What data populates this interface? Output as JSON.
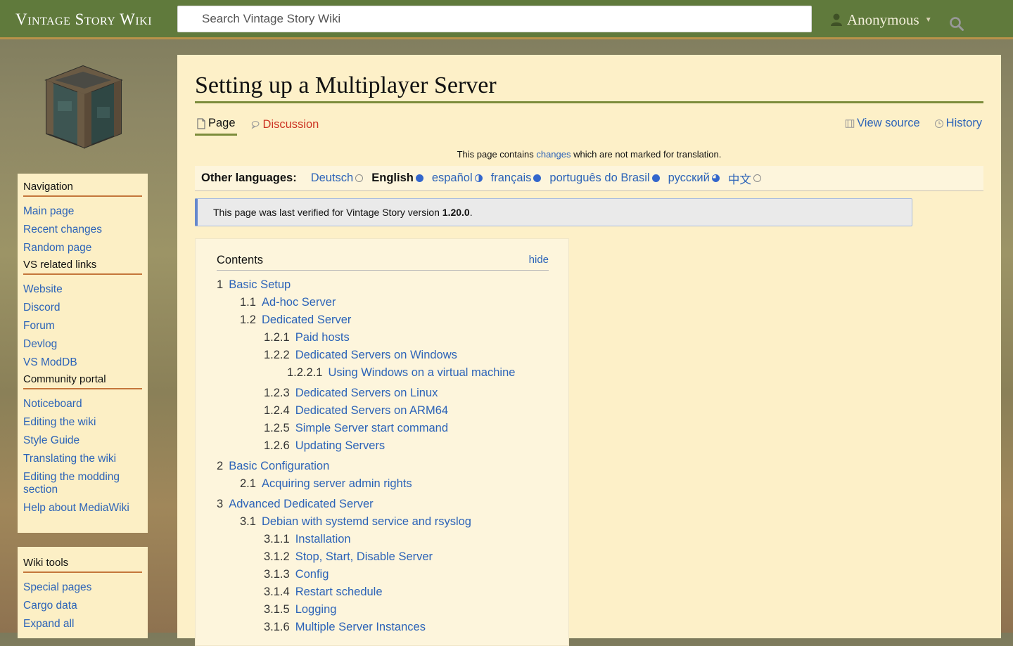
{
  "header": {
    "brand": "Vintage Story Wiki",
    "search_placeholder": "Search Vintage Story Wiki",
    "user_label": "Anonymous"
  },
  "sidebar": {
    "navigation_heading": "Navigation",
    "navigation": [
      "Main page",
      "Recent changes",
      "Random page"
    ],
    "vs_heading": "VS related links",
    "vs_links": [
      "Website",
      "Discord",
      "Forum",
      "Devlog",
      "VS ModDB"
    ],
    "community_heading": "Community portal",
    "community": [
      "Noticeboard",
      "Editing the wiki",
      "Style Guide",
      "Translating the wiki",
      "Editing the modding section",
      "Help about MediaWiki"
    ],
    "tools_heading": "Wiki tools",
    "tools": [
      "Special pages",
      "Cargo data",
      "Expand all"
    ]
  },
  "page": {
    "title": "Setting up a Multiplayer Server",
    "tab_page": "Page",
    "tab_discussion": "Discussion",
    "tab_view_source": "View source",
    "tab_history": "History",
    "notice_before": "This page contains ",
    "notice_link": "changes",
    "notice_after": " which are not marked for translation.",
    "languages_label": "Other languages:",
    "languages": [
      {
        "name": "Deutsch",
        "status": "empty"
      },
      {
        "name": "English",
        "status": "full"
      },
      {
        "name": "español",
        "status": "half"
      },
      {
        "name": "français",
        "status": "full"
      },
      {
        "name": "português do Brasil",
        "status": "full"
      },
      {
        "name": "русский",
        "status": "mostly"
      },
      {
        "name": "中文",
        "status": "empty"
      }
    ],
    "verify_text": "This page was last verified for Vintage Story version ",
    "verify_version": "1.20.0",
    "verify_end": "."
  },
  "toc": {
    "title": "Contents",
    "hide": "hide",
    "items": [
      {
        "num": "1",
        "text": "Basic Setup",
        "level": 1
      },
      {
        "num": "1.1",
        "text": "Ad-hoc Server",
        "level": 2
      },
      {
        "num": "1.2",
        "text": "Dedicated Server",
        "level": 2
      },
      {
        "num": "1.2.1",
        "text": "Paid hosts",
        "level": 3
      },
      {
        "num": "1.2.2",
        "text": "Dedicated Servers on Windows",
        "level": 3
      },
      {
        "num": "1.2.2.1",
        "text": "Using Windows on a virtual machine",
        "level": 4
      },
      {
        "num": "1.2.3",
        "text": "Dedicated Servers on Linux",
        "level": 3
      },
      {
        "num": "1.2.4",
        "text": "Dedicated Servers on ARM64",
        "level": 3
      },
      {
        "num": "1.2.5",
        "text": "Simple Server start command",
        "level": 3
      },
      {
        "num": "1.2.6",
        "text": "Updating Servers",
        "level": 3
      },
      {
        "num": "2",
        "text": "Basic Configuration",
        "level": 1
      },
      {
        "num": "2.1",
        "text": "Acquiring server admin rights",
        "level": 2
      },
      {
        "num": "3",
        "text": "Advanced Dedicated Server",
        "level": 1
      },
      {
        "num": "3.1",
        "text": "Debian with systemd service and rsyslog",
        "level": 2
      },
      {
        "num": "3.1.1",
        "text": "Installation",
        "level": 3
      },
      {
        "num": "3.1.2",
        "text": "Stop, Start, Disable Server",
        "level": 3
      },
      {
        "num": "3.1.3",
        "text": "Config",
        "level": 3
      },
      {
        "num": "3.1.4",
        "text": "Restart schedule",
        "level": 3
      },
      {
        "num": "3.1.5",
        "text": "Logging",
        "level": 3
      },
      {
        "num": "3.1.6",
        "text": "Multiple Server Instances",
        "level": 3
      }
    ]
  },
  "colors": {
    "header": "#607a3c",
    "link": "#2c63b8",
    "panel": "#fcefc5",
    "accent": "#c4763b"
  }
}
